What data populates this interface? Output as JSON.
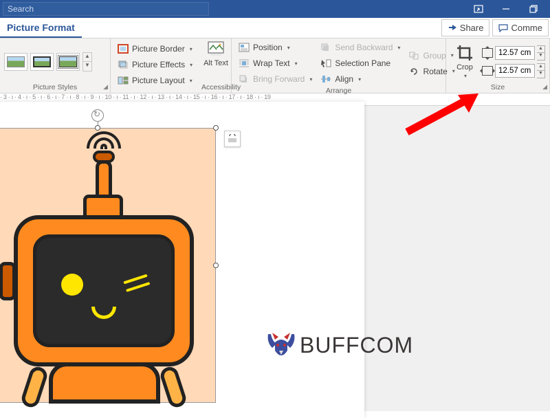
{
  "titlebar": {
    "search_placeholder": "Search"
  },
  "tabs": {
    "active": "Picture Format",
    "share": "Share",
    "comment": "Comme"
  },
  "ribbon": {
    "styles_label": "Picture Styles",
    "border": "Picture Border",
    "effects": "Picture Effects",
    "layout": "Picture Layout",
    "alt_text": "Alt Text",
    "accessibility_label": "Accessibility",
    "position": "Position",
    "wrap": "Wrap Text",
    "bring_forward": "Bring Forward",
    "send_backward": "Send Backward",
    "selection_pane": "Selection Pane",
    "align": "Align",
    "group": "Group",
    "rotate": "Rotate",
    "arrange_label": "Arrange",
    "crop": "Crop",
    "size_label": "Size",
    "height_value": "12.57 cm",
    "width_value": "12.57 cm"
  },
  "ruler": {
    "text": "· 3 · ı · 4 · ı · 5 · ı · 6 · ı · 7 · ı · 8 · ı · 9 · ı · 10 · ı · 11 · ı · 12 · ı · 13 · ı · 14 · ı · 15 · ı · 16 · ı · 17 · ı · 18 · ı · 19"
  },
  "watermark": {
    "text": "BUFFCOM"
  }
}
